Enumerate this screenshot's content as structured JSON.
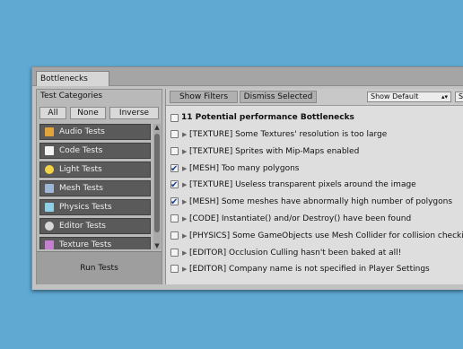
{
  "window": {
    "tab_label": "Bottlenecks"
  },
  "categories": {
    "title": "Test Categories",
    "filters": [
      "All",
      "None",
      "Inverse"
    ],
    "items": [
      {
        "label": "Audio Tests",
        "icon": "speaker-icon",
        "color": "#e0a43a"
      },
      {
        "label": "Code Tests",
        "icon": "document-icon",
        "color": "#f2f2f2"
      },
      {
        "label": "Light Tests",
        "icon": "lightbulb-icon",
        "color": "#f4d247"
      },
      {
        "label": "Mesh Tests",
        "icon": "mesh-grid-icon",
        "color": "#9fb6d6"
      },
      {
        "label": "Physics Tests",
        "icon": "physics-cube-icon",
        "color": "#8fd0e6"
      },
      {
        "label": "Editor Tests",
        "icon": "unity-logo-icon",
        "color": "#d8d8d8"
      },
      {
        "label": "Texture Tests",
        "icon": "image-icon",
        "color": "#c47fd0"
      }
    ],
    "run_label": "Run Tests"
  },
  "toolbar": {
    "show_filters": "Show Filters",
    "dismiss_selected": "Dismiss Selected",
    "sort_selected": "Show Default",
    "extra_button": "S"
  },
  "summary": "11 Potential performance Bottlenecks",
  "issues": [
    {
      "text": "[TEXTURE] Some Textures' resolution is too large",
      "checked": false
    },
    {
      "text": "[TEXTURE] Sprites with Mip-Maps enabled",
      "checked": false
    },
    {
      "text": "[MESH] Too many polygons",
      "checked": true
    },
    {
      "text": "[TEXTURE] Useless transparent pixels around the image",
      "checked": true
    },
    {
      "text": "[MESH] Some meshes have abnormally high number of polygons",
      "checked": true
    },
    {
      "text": "[CODE] Instantiate() and/or Destroy() have been found",
      "checked": false
    },
    {
      "text": "[PHYSICS] Some GameObjects use Mesh Collider for collision checking",
      "checked": false
    },
    {
      "text": "[EDITOR] Occlusion Culling hasn't been baked at all!",
      "checked": false
    },
    {
      "text": "[EDITOR] Company name is not specified in Player Settings",
      "checked": false
    }
  ]
}
